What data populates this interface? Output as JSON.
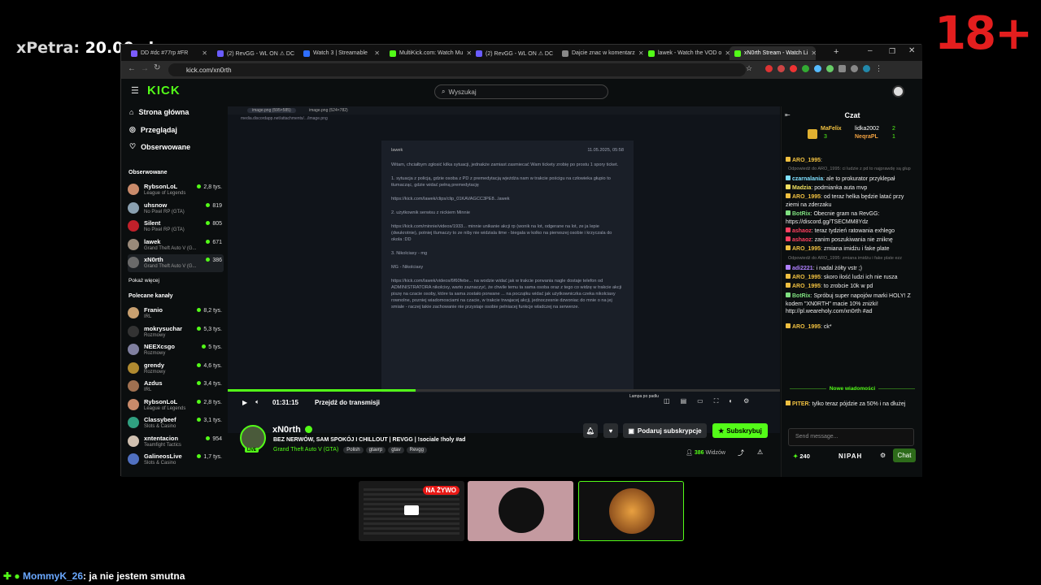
{
  "overlay": {
    "donation_name": "xPetra:",
    "donation_amount": "20.00 zł",
    "age_badge": "18+",
    "bottom_chat_user": "MommyK_26",
    "bottom_chat_text": ": ja nie jestem smutna",
    "live_badge": "NA ŻYWO"
  },
  "browser": {
    "tabs": [
      {
        "title": "DD #dc #77rp #FR",
        "color": "#7b5cff"
      },
      {
        "title": "(2) RevGG - WL ON ⚠ DC",
        "color": "#6a5cff"
      },
      {
        "title": "Watch 3 | Streamable",
        "color": "#2f6fff"
      },
      {
        "title": "MultiKick.com: Watch Mu",
        "color": "#53fc18"
      },
      {
        "title": "(2) RevGG - WL ON ⚠ DC",
        "color": "#6a5cff"
      },
      {
        "title": "Dajcie znac w komentarz",
        "color": "#888888"
      },
      {
        "title": "lawek - Watch the VOD o",
        "color": "#53fc18"
      },
      {
        "title": "xN0rth Stream - Watch Li",
        "color": "#53fc18"
      }
    ],
    "url": "kick.com/xn0rth"
  },
  "kick": {
    "logo": "KICK",
    "search_placeholder": "Wyszukaj",
    "nav": [
      {
        "label": "Strona główna",
        "icon": "home-icon"
      },
      {
        "label": "Przeglądaj",
        "icon": "compass-icon"
      },
      {
        "label": "Obserwowane",
        "icon": "heart-icon"
      }
    ],
    "followed_header": "Obserwowane",
    "followed": [
      {
        "name": "RybsonLoL",
        "category": "League of Legends",
        "viewers": "2,8 tys.",
        "color": "#c98a6a"
      },
      {
        "name": "uhsnow",
        "category": "No Pixel RP (GTA)",
        "viewers": "819",
        "color": "#8aa0b0"
      },
      {
        "name": "Silent",
        "category": "No Pixel RP (GTA)",
        "viewers": "805",
        "color": "#c0202a"
      },
      {
        "name": "lawek",
        "category": "Grand Theft Auto V (G...",
        "viewers": "671",
        "color": "#9a8a7a"
      },
      {
        "name": "xN0rth",
        "category": "Grand Theft Auto V (G...",
        "viewers": "386",
        "color": "#6a6a6a"
      }
    ],
    "show_more": "Pokaż więcej",
    "recommended_header": "Polecane kanały",
    "recommended": [
      {
        "name": "Franio",
        "category": "IRL",
        "viewers": "8,2 tys.",
        "color": "#c8a070"
      },
      {
        "name": "mokrysuchar",
        "category": "Rozmowy",
        "viewers": "5,3 tys.",
        "color": "#333333"
      },
      {
        "name": "NEEXcsgo",
        "category": "Rozmowy",
        "viewers": "5 tys.",
        "color": "#8080a0"
      },
      {
        "name": "grendy",
        "category": "Rozmowy",
        "viewers": "4,6 tys.",
        "color": "#b08a30"
      },
      {
        "name": "Azdus",
        "category": "IRL",
        "viewers": "3,4 tys.",
        "color": "#a07050"
      },
      {
        "name": "RybsonLoL",
        "category": "League of Legends",
        "viewers": "2,8 tys.",
        "color": "#c98a6a"
      },
      {
        "name": "Classybeef",
        "category": "Slots & Casino",
        "viewers": "3,1 tys.",
        "color": "#30a080"
      },
      {
        "name": "xntentacion",
        "category": "Teamfight Tactics",
        "viewers": "954",
        "color": "#d0c0b0"
      },
      {
        "name": "GalineosLive",
        "category": "Slots & Casino",
        "viewers": "1,7 tys.",
        "color": "#5070c0"
      }
    ],
    "player": {
      "time": "01:31:15",
      "skip_label": "Przejdź do transmisji",
      "tooltip": "Lampa po padlu",
      "progress": 0.34
    },
    "stream": {
      "streamer": "xN0rth",
      "title": "BEZ NERWÓW, SAM SPOKÓJ I CHILLOUT",
      "title_suffix": "| REVGG | !sociale !holy #ad",
      "category": "Grand Theft Auto V (GTA)",
      "tags": [
        "Polish",
        "gtavrp",
        "gtav",
        "Revgg"
      ],
      "viewers": "386",
      "viewers_label": "Widzów",
      "gift_label": "Podaruj subskrypcje",
      "subscribe_label": "Subskrybuj",
      "live_label": "LIVE"
    },
    "chat": {
      "header": "Czat",
      "leaders": [
        {
          "name": "MaFelix",
          "count": "3"
        },
        {
          "name": "lidka2002",
          "count": "2"
        },
        {
          "name": "NeqraPL",
          "count": "1"
        }
      ],
      "messages": [
        {
          "user": "ARO_1995",
          "text": ":",
          "color": "#f0c040"
        },
        {
          "reply": "Odpowiedź do ARO_1995: ci ludzie z pd to najprawdę są głup"
        },
        {
          "user": "czarnalania",
          "text": ": ale to prokurator przyklepał",
          "color": "#7fe0ff"
        },
        {
          "user": "Madzia",
          "text": ": podmianka auta mvp",
          "color": "#f0e060"
        },
        {
          "user": "ARO_1995",
          "text": ": od teraz helka będzie latać przy ziemi na zderzaku",
          "color": "#f0c040"
        },
        {
          "user": "BotRix",
          "text": ": Obecnie gram na RevGG: https://discord.gg/TSECMM8Ydz",
          "color": "#7fe07f"
        },
        {
          "user": "ashaoz",
          "text": ": teraz tydzień ratowania exhlego",
          "color": "#ff4060"
        },
        {
          "user": "ashaoz",
          "text": ": zanim poszukiwania nie zniknę",
          "color": "#ff4060"
        },
        {
          "user": "ARO_1995",
          "text": ": zmiana imidżu i fake plate",
          "color": "#f0c040"
        },
        {
          "reply": "Odpowiedź do ARO_1995: zmiana imidżu i fake plate ezz"
        },
        {
          "user": "adi2221",
          "text": ": i nadal żółty vstr ;)",
          "color": "#b080ff"
        },
        {
          "user": "ARO_1995",
          "text": ": skoro ilość ludzi ich nie rusza",
          "color": "#f0c040"
        },
        {
          "user": "ARO_1995",
          "text": ": to zrobcie 10k w pd",
          "color": "#f0c040"
        },
        {
          "user": "BotRix",
          "text": ": Spróbuj super napojów marki HOLY! Z kodem \"XN0RTH\" macie 10% zniżki! http://pl.weareholy.com/xn0rth #ad",
          "color": "#7fe07f"
        },
        {
          "user": "ARO_1995",
          "text": ": ck*",
          "color": "#f0c040"
        }
      ],
      "new_messages": "Nowe wiadomości",
      "last_message": {
        "user": "PITER",
        "text": ": tylko teraz pójdzie za 50% i na dłużej",
        "color": "#f0c040"
      },
      "input_placeholder": "Send message...",
      "points": "240",
      "emote_label": "NIPAH",
      "send_label": "Chat"
    }
  },
  "document": {
    "author": "lawek",
    "date": "11.05.2025, 05:58",
    "paragraphs": [
      "Witam, chciałbym zgłosić kilka sytuacji, jednakże zamiast zasmiecać Wam tickety zrobię po prostu 1 spory ticket.",
      "1. sytuacja z policją, gdzie osoba z PD z premedytacją wjeżdża nam w trakcie pościgu na człowieka głupio to tłumacząc, gdzie widać pełną premedytację",
      "https://kick.com/lawek/clips/clip_01KAVAGCC3PE8...lawek",
      "2. użytkownik serwisu z nickiem Minnie",
      "https://kick.com/minnie/videos/1933... minnie unikanie akcji rp (wonik na lot, odgerane na lot, ze ja lepie (dwukrotnie), potniej tlumaczy to ze niby nie widziala itme - biegala w kolko na pierwszej osobie i krzyczala do okola :DD",
      "3. Nikolciaxy - mg",
      "MG - Nikolciaxy",
      "https://kick.com/lawek/videos/6f60febe... na wodzie widać jak w trakcie porwania nagle dostaje telefon od ADMINISTRATORA nikolcixy, warto zaznaczyć, że chwile temu ta sama osoba oraz z tego co widzę w trakcie akcji piszę na czacie osoby, które ta sama zostało porwane ... na początku widać jak użytkowniczka czeka nikolciaxy rownolne, pozniej wiadomosciami na czacie, w trakcie trwajacej akcji, jednoczesnie dzwoniac do mnie o na jej smiale - raczej takie zachowanie nie przystaje osobie pelniacej funkcje wladczej na serwerze."
    ],
    "tab1": "image.png (595×585)",
    "tab2": "image.png (524×782)",
    "url": "media.discordapp.net/attachments/.../image.png"
  },
  "colors": {
    "kick_green": "#53fc18",
    "bg": "#0b0e0f",
    "live_red": "#e91916"
  }
}
